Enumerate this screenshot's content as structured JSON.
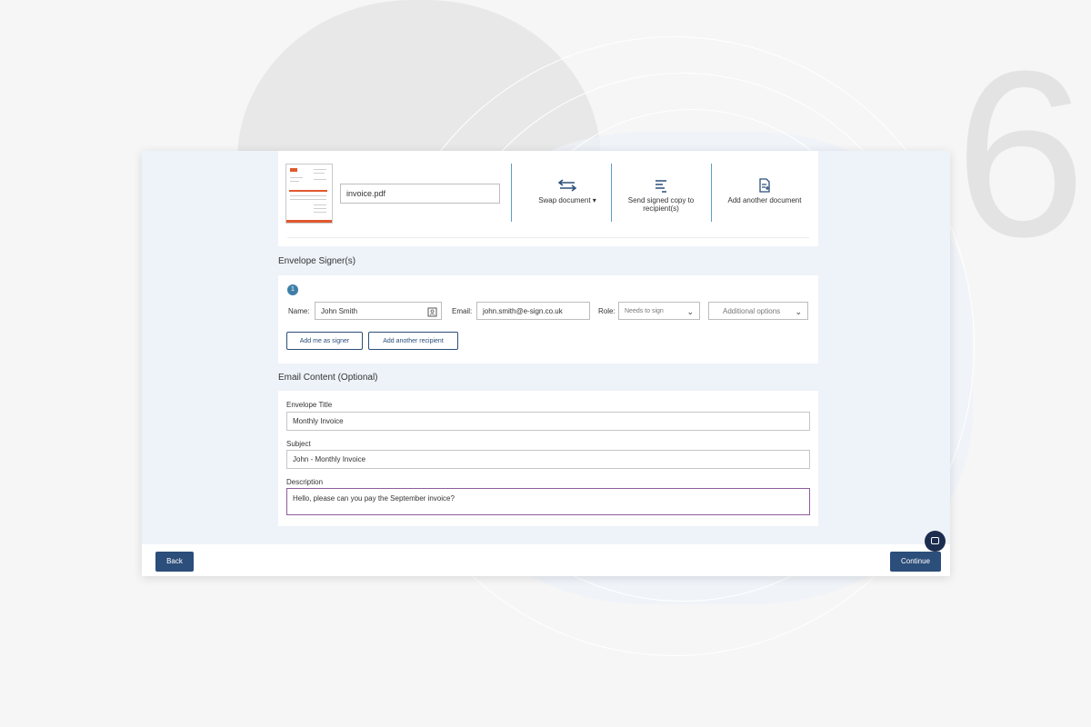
{
  "document": {
    "filename": "invoice.pdf",
    "actions": [
      {
        "label": "Swap document ▾",
        "icon": "swap-arrows-icon"
      },
      {
        "label": "Send signed copy to recipient(s)",
        "icon": "align-lines-icon"
      },
      {
        "label": "Add another document",
        "icon": "add-document-icon"
      }
    ]
  },
  "signers": {
    "section_title": "Envelope Signer(s)",
    "number": "1",
    "name_label": "Name:",
    "name_value": "John Smith",
    "email_label": "Email:",
    "email_value": "john.smith@e-sign.co.uk",
    "role_label": "Role:",
    "role_value": "Needs to sign",
    "additional_options": "Additional options",
    "add_me_button": "Add me as signer",
    "add_recipient_button": "Add another recipient"
  },
  "email_content": {
    "section_title": "Email Content (Optional)",
    "envelope_title_label": "Envelope Title",
    "envelope_title_value": "Monthly Invoice",
    "subject_label": "Subject",
    "subject_value": "John - Monthly Invoice",
    "description_label": "Description",
    "description_value": "Hello, please can you pay the September invoice?"
  },
  "footer": {
    "back_label": "Back",
    "continue_label": "Continue"
  },
  "background": {
    "step_number": "6"
  },
  "colors": {
    "primary": "#2b4e7a",
    "accent_separator": "#5b9fc7",
    "active_border": "#8f5c9c",
    "chat_bubble": "#1c2d4f"
  }
}
